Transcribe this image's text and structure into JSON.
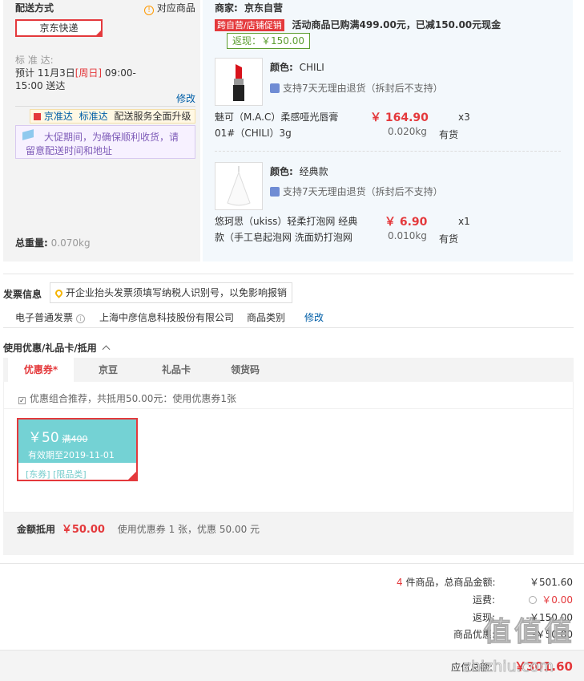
{
  "shipping": {
    "title": "配送方式",
    "corresponding_goods": "对应商品",
    "method": "京东快递",
    "standard_label": "标 准 达:",
    "estimate": "预计 11月3日[周日] 09:00-15:00 送达",
    "estimate_pre": "预计 11月3日",
    "estimate_weekday": "[周日]",
    "estimate_post": " 09:00-",
    "estimate_line2": "15:00 送达",
    "modify": "修改",
    "upgrade_brand": "京准达",
    "upgrade_text1": "标准达",
    "upgrade_text2": "配送服务全面升级",
    "notice": "大促期间，为确保顺利收货，请留意配送时间和地址",
    "notice_line1": "大促期间，为确保顺利收货，请",
    "notice_line2": "留意配送时间和地址",
    "total_weight_label": "总重量:",
    "total_weight_value": "0.070kg"
  },
  "merchant": {
    "label": "商家:",
    "name": "京东自营",
    "promo_tag": "跨自营/店铺促销",
    "promo_text": "活动商品已购满499.00元，已减150.00元现金",
    "cashback": "返现：￥150.00"
  },
  "products": [
    {
      "color_label": "颜色:",
      "color": "CHILI",
      "return_policy": "支持7天无理由退货（拆封后不支持）",
      "name_line1": "魅可（M.A.C）柔感哑光唇膏",
      "name_line2": "01#（CHILI）3g",
      "price": "￥ 164.90",
      "qty": "x3",
      "weight": "0.020kg",
      "stock": "有货"
    },
    {
      "color_label": "颜色:",
      "color": "经典款",
      "return_policy": "支持7天无理由退货（拆封后不支持）",
      "name_line1": "悠珂思（ukiss）轻柔打泡网 经典",
      "name_line2": "款（手工皂起泡网 洗面奶打泡网",
      "price": "￥ 6.90",
      "qty": "x1",
      "weight": "0.010kg",
      "stock": "有货"
    }
  ],
  "invoice": {
    "title": "发票信息",
    "tip": "开企业抬头发票须填写纳税人识别号，以免影响报销",
    "type": "电子普通发票",
    "company": "上海中彦信息科技股份有限公司",
    "category": "商品类别",
    "modify": "修改"
  },
  "discount": {
    "title": "使用优惠/礼品卡/抵用",
    "tabs": [
      "优惠券*",
      "京豆",
      "礼品卡",
      "领货码"
    ],
    "recommend": "优惠组合推荐，共抵用50.00元：使用优惠券1张",
    "coupon": {
      "amount": "￥50",
      "threshold": "满400",
      "validity": "有效期至2019-11-01",
      "tags": "[东券] [限品类]"
    },
    "summary_label": "金额抵用",
    "summary_amount": "￥50.00",
    "summary_text": "使用优惠券 1 张，优惠 50.00 元"
  },
  "totals": {
    "count": "4",
    "count_suffix": "件商品，总商品金额:",
    "goods_amount": "￥501.60",
    "shipping_label": "运费:",
    "shipping_amount": "￥0.00",
    "cashback_label": "返现:",
    "cashback_amount": "-￥150.00",
    "coupon_label": "商品优惠:",
    "coupon_amount": "-￥50.00",
    "payable_label": "应付总额:",
    "payable_amount": "￥301.60"
  },
  "watermark": "值 值 值",
  "watermark_url": "zhizhiu.com",
  "colors": {
    "accent_red": "#e4393c",
    "link_blue": "#005ea7",
    "coupon_teal": "#74d2d4",
    "cashback_green": "#5c9d2f"
  }
}
